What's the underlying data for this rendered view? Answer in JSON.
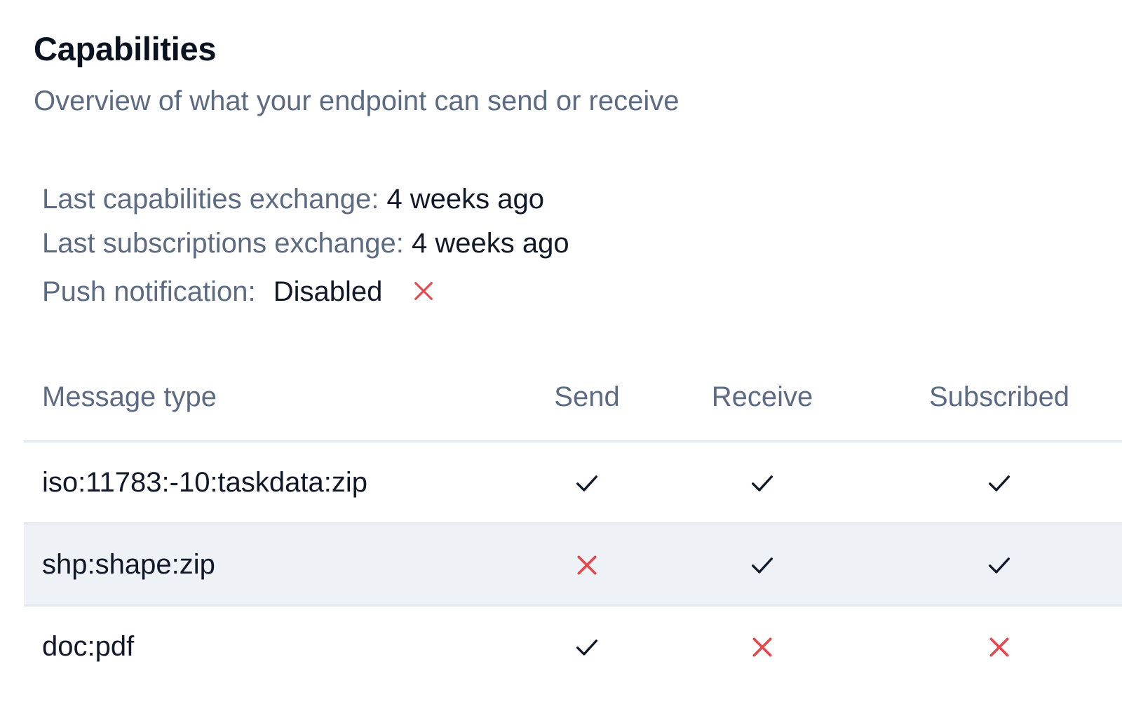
{
  "section": {
    "title": "Capabilities",
    "subtitle": "Overview of what your endpoint can send or receive"
  },
  "info": {
    "last_capabilities_label": "Last capabilities exchange:",
    "last_capabilities_value": "4 weeks ago",
    "last_subscriptions_label": "Last subscriptions exchange:",
    "last_subscriptions_value": "4 weeks ago",
    "push_label": "Push notification:",
    "push_value": "Disabled",
    "push_enabled": false
  },
  "table": {
    "columns": [
      "Message type",
      "Send",
      "Receive",
      "Subscribed"
    ],
    "rows": [
      {
        "type": "iso:11783:-10:taskdata:zip",
        "send": true,
        "receive": true,
        "subscribed": true
      },
      {
        "type": "shp:shape:zip",
        "send": false,
        "receive": true,
        "subscribed": true
      },
      {
        "type": "doc:pdf",
        "send": true,
        "receive": false,
        "subscribed": false
      }
    ]
  },
  "icons": {
    "yes": "check-icon",
    "no": "x-icon"
  },
  "colors": {
    "check": "#111827",
    "cross": "#e5484d",
    "muted_text": "#5d6b82",
    "row_alt_bg": "#eef2f7",
    "divider": "#e2e8f0"
  }
}
